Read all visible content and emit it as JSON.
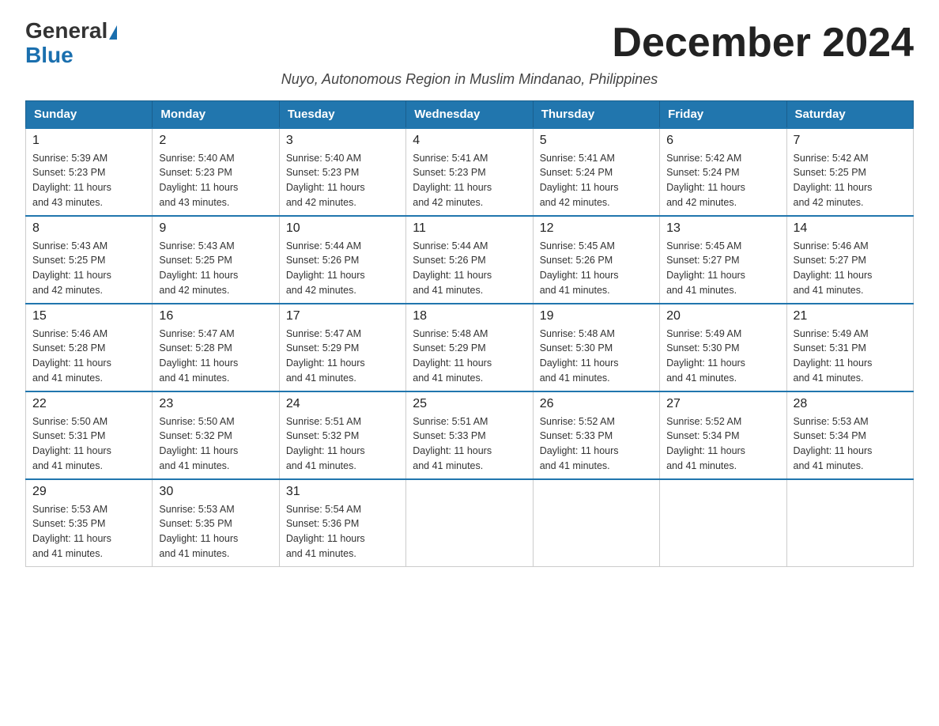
{
  "logo": {
    "general": "General",
    "blue": "Blue"
  },
  "title": "December 2024",
  "subtitle": "Nuyo, Autonomous Region in Muslim Mindanao, Philippines",
  "days_of_week": [
    "Sunday",
    "Monday",
    "Tuesday",
    "Wednesday",
    "Thursday",
    "Friday",
    "Saturday"
  ],
  "weeks": [
    [
      {
        "day": "1",
        "sunrise": "5:39 AM",
        "sunset": "5:23 PM",
        "daylight": "11 hours and 43 minutes."
      },
      {
        "day": "2",
        "sunrise": "5:40 AM",
        "sunset": "5:23 PM",
        "daylight": "11 hours and 43 minutes."
      },
      {
        "day": "3",
        "sunrise": "5:40 AM",
        "sunset": "5:23 PM",
        "daylight": "11 hours and 42 minutes."
      },
      {
        "day": "4",
        "sunrise": "5:41 AM",
        "sunset": "5:23 PM",
        "daylight": "11 hours and 42 minutes."
      },
      {
        "day": "5",
        "sunrise": "5:41 AM",
        "sunset": "5:24 PM",
        "daylight": "11 hours and 42 minutes."
      },
      {
        "day": "6",
        "sunrise": "5:42 AM",
        "sunset": "5:24 PM",
        "daylight": "11 hours and 42 minutes."
      },
      {
        "day": "7",
        "sunrise": "5:42 AM",
        "sunset": "5:25 PM",
        "daylight": "11 hours and 42 minutes."
      }
    ],
    [
      {
        "day": "8",
        "sunrise": "5:43 AM",
        "sunset": "5:25 PM",
        "daylight": "11 hours and 42 minutes."
      },
      {
        "day": "9",
        "sunrise": "5:43 AM",
        "sunset": "5:25 PM",
        "daylight": "11 hours and 42 minutes."
      },
      {
        "day": "10",
        "sunrise": "5:44 AM",
        "sunset": "5:26 PM",
        "daylight": "11 hours and 42 minutes."
      },
      {
        "day": "11",
        "sunrise": "5:44 AM",
        "sunset": "5:26 PM",
        "daylight": "11 hours and 41 minutes."
      },
      {
        "day": "12",
        "sunrise": "5:45 AM",
        "sunset": "5:26 PM",
        "daylight": "11 hours and 41 minutes."
      },
      {
        "day": "13",
        "sunrise": "5:45 AM",
        "sunset": "5:27 PM",
        "daylight": "11 hours and 41 minutes."
      },
      {
        "day": "14",
        "sunrise": "5:46 AM",
        "sunset": "5:27 PM",
        "daylight": "11 hours and 41 minutes."
      }
    ],
    [
      {
        "day": "15",
        "sunrise": "5:46 AM",
        "sunset": "5:28 PM",
        "daylight": "11 hours and 41 minutes."
      },
      {
        "day": "16",
        "sunrise": "5:47 AM",
        "sunset": "5:28 PM",
        "daylight": "11 hours and 41 minutes."
      },
      {
        "day": "17",
        "sunrise": "5:47 AM",
        "sunset": "5:29 PM",
        "daylight": "11 hours and 41 minutes."
      },
      {
        "day": "18",
        "sunrise": "5:48 AM",
        "sunset": "5:29 PM",
        "daylight": "11 hours and 41 minutes."
      },
      {
        "day": "19",
        "sunrise": "5:48 AM",
        "sunset": "5:30 PM",
        "daylight": "11 hours and 41 minutes."
      },
      {
        "day": "20",
        "sunrise": "5:49 AM",
        "sunset": "5:30 PM",
        "daylight": "11 hours and 41 minutes."
      },
      {
        "day": "21",
        "sunrise": "5:49 AM",
        "sunset": "5:31 PM",
        "daylight": "11 hours and 41 minutes."
      }
    ],
    [
      {
        "day": "22",
        "sunrise": "5:50 AM",
        "sunset": "5:31 PM",
        "daylight": "11 hours and 41 minutes."
      },
      {
        "day": "23",
        "sunrise": "5:50 AM",
        "sunset": "5:32 PM",
        "daylight": "11 hours and 41 minutes."
      },
      {
        "day": "24",
        "sunrise": "5:51 AM",
        "sunset": "5:32 PM",
        "daylight": "11 hours and 41 minutes."
      },
      {
        "day": "25",
        "sunrise": "5:51 AM",
        "sunset": "5:33 PM",
        "daylight": "11 hours and 41 minutes."
      },
      {
        "day": "26",
        "sunrise": "5:52 AM",
        "sunset": "5:33 PM",
        "daylight": "11 hours and 41 minutes."
      },
      {
        "day": "27",
        "sunrise": "5:52 AM",
        "sunset": "5:34 PM",
        "daylight": "11 hours and 41 minutes."
      },
      {
        "day": "28",
        "sunrise": "5:53 AM",
        "sunset": "5:34 PM",
        "daylight": "11 hours and 41 minutes."
      }
    ],
    [
      {
        "day": "29",
        "sunrise": "5:53 AM",
        "sunset": "5:35 PM",
        "daylight": "11 hours and 41 minutes."
      },
      {
        "day": "30",
        "sunrise": "5:53 AM",
        "sunset": "5:35 PM",
        "daylight": "11 hours and 41 minutes."
      },
      {
        "day": "31",
        "sunrise": "5:54 AM",
        "sunset": "5:36 PM",
        "daylight": "11 hours and 41 minutes."
      },
      null,
      null,
      null,
      null
    ]
  ],
  "labels": {
    "sunrise": "Sunrise:",
    "sunset": "Sunset:",
    "daylight": "Daylight:"
  }
}
